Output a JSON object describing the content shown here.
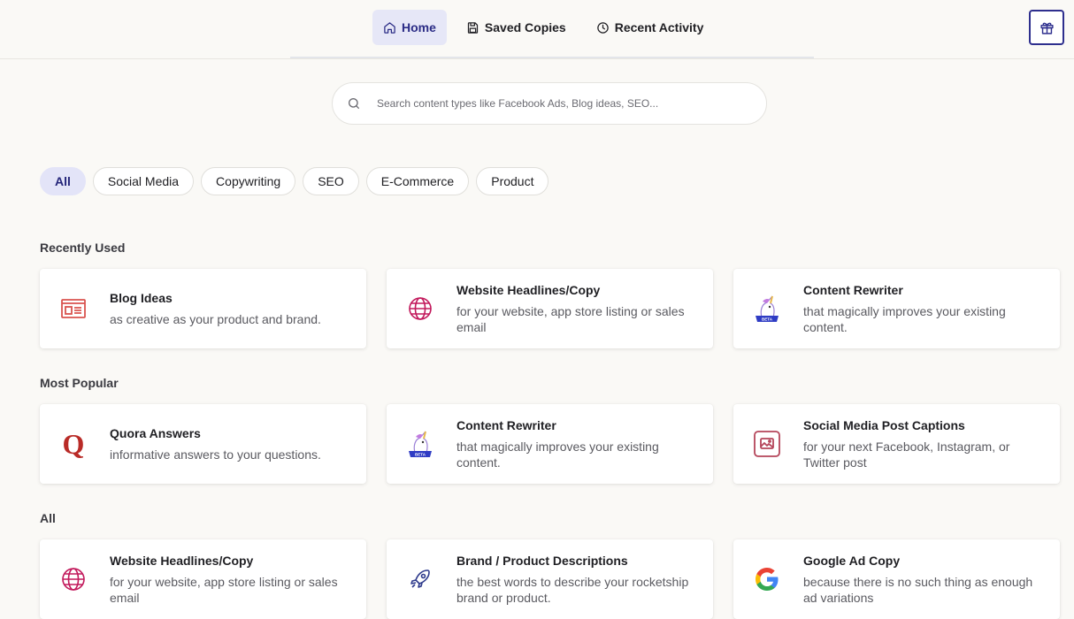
{
  "nav": {
    "items": [
      {
        "label": "Home",
        "icon": "home-icon",
        "active": true
      },
      {
        "label": "Saved Copies",
        "icon": "save-icon",
        "active": false
      },
      {
        "label": "Recent Activity",
        "icon": "clock-icon",
        "active": false
      }
    ],
    "gift_icon": "gift-icon"
  },
  "search": {
    "placeholder": "Search content types like Facebook Ads, Blog ideas, SEO...",
    "value": ""
  },
  "filters": [
    "All",
    "Social Media",
    "Copywriting",
    "SEO",
    "E-Commerce",
    "Product"
  ],
  "sections": {
    "recent": {
      "title": "Recently Used",
      "cards": [
        {
          "title": "Blog Ideas",
          "desc": "as creative as your product and brand.",
          "icon": "blog-icon"
        },
        {
          "title": "Website Headlines/Copy",
          "desc": "for your website, app store listing or sales email",
          "icon": "globe-icon"
        },
        {
          "title": "Content Rewriter",
          "desc": "that magically improves your existing content.",
          "icon": "unicorn-icon",
          "badge": "BETA"
        }
      ]
    },
    "popular": {
      "title": "Most Popular",
      "cards": [
        {
          "title": "Quora Answers",
          "desc": "informative answers to your questions.",
          "icon": "quora-icon",
          "glyph": "Q"
        },
        {
          "title": "Content Rewriter",
          "desc": "that magically improves your existing content.",
          "icon": "unicorn-icon",
          "badge": "BETA"
        },
        {
          "title": "Social Media Post Captions",
          "desc": "for your next Facebook, Instagram, or Twitter post",
          "icon": "image-icon"
        }
      ]
    },
    "all": {
      "title": "All",
      "cards": [
        {
          "title": "Website Headlines/Copy",
          "desc": "for your website, app store listing or sales email",
          "icon": "globe-icon"
        },
        {
          "title": "Brand / Product Descriptions",
          "desc": "the best words to describe your rocketship brand or product.",
          "icon": "rocket-icon"
        },
        {
          "title": "Google Ad Copy",
          "desc": "because there is no such thing as enough ad variations",
          "icon": "google-icon",
          "glyph": "G"
        }
      ]
    }
  },
  "colors": {
    "accent": "#2e2f8e",
    "active_bg": "#e6e7f7",
    "blog_red": "#d9534f",
    "globe_pink": "#c2185b",
    "quora_red": "#b92b27",
    "image_red": "#b5455a",
    "rocket_blue": "#2e3a8c",
    "beta_blue": "#2f3cc4"
  }
}
